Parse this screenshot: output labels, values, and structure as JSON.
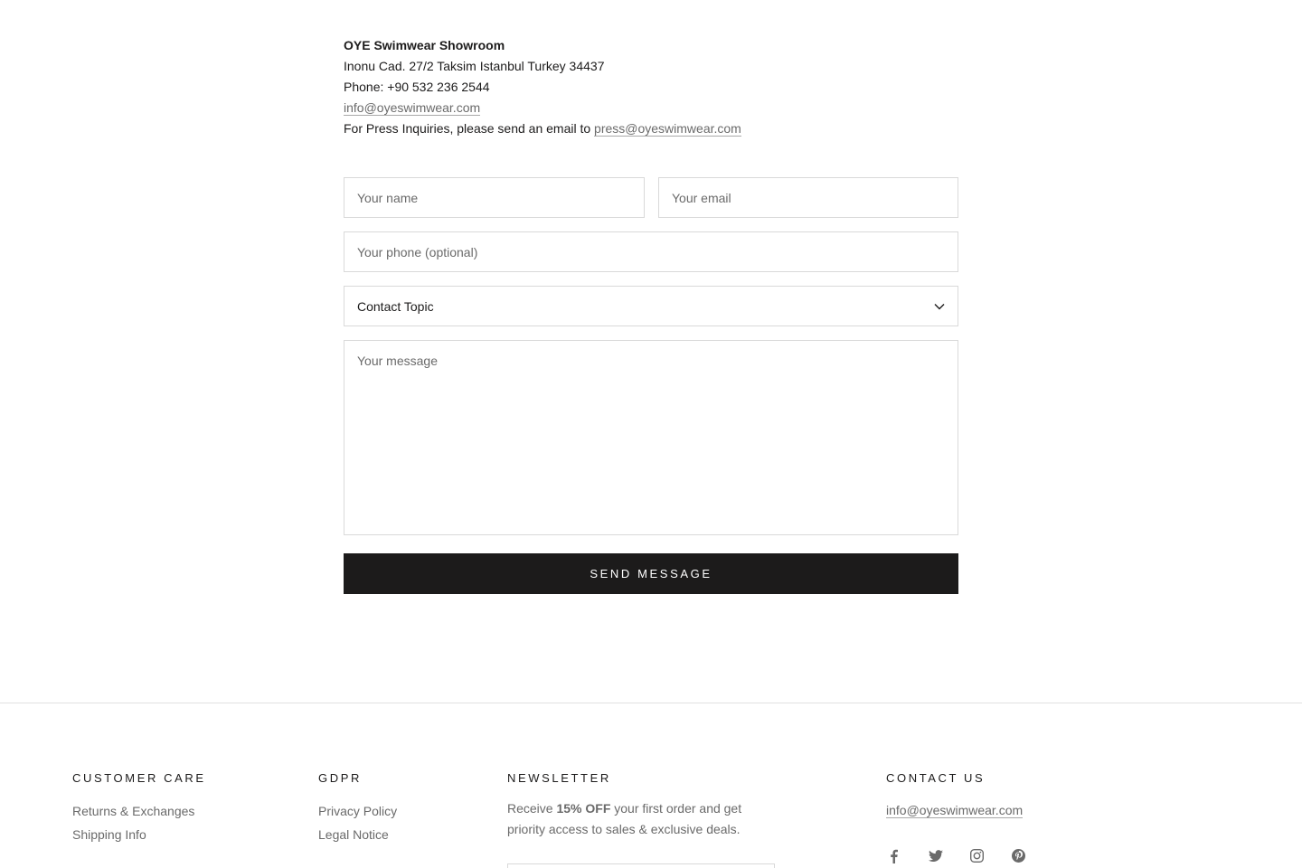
{
  "showroom": {
    "title": "OYE Swimwear Showroom",
    "address": "Inonu Cad. 27/2 Taksim Istanbul Turkey 34437",
    "phone": "Phone: +90 532 236 2544",
    "email": "info@oyeswimwear.com",
    "press_text": "For Press Inquiries, please send an email to",
    "press_email": "press@oyeswimwear.com"
  },
  "form": {
    "name_placeholder": "Your name",
    "email_placeholder": "Your email",
    "phone_placeholder": "Your phone (optional)",
    "topic_selected": "Contact Topic",
    "message_placeholder": "Your message",
    "send_label": "SEND MESSAGE"
  },
  "footer": {
    "customer_care": {
      "heading": "CUSTOMER CARE",
      "items": [
        "Returns & Exchanges",
        "Shipping Info"
      ]
    },
    "gdpr": {
      "heading": "GDPR",
      "items": [
        "Privacy Policy",
        "Legal Notice"
      ]
    },
    "newsletter": {
      "heading": "NEWSLETTER",
      "text_before": "Receive ",
      "text_bold": "15% OFF",
      "text_after": " your first order and get priority access to sales & exclusive deals."
    },
    "contact": {
      "heading": "CONTACT US",
      "email": "info@oyeswimwear.com"
    },
    "socials": [
      "facebook-icon",
      "twitter-icon",
      "instagram-icon",
      "pinterest-icon"
    ]
  },
  "colors": {
    "primary": "#1c1b1b",
    "muted_text": "#6a6a6a",
    "border": "#d9d9d9"
  }
}
